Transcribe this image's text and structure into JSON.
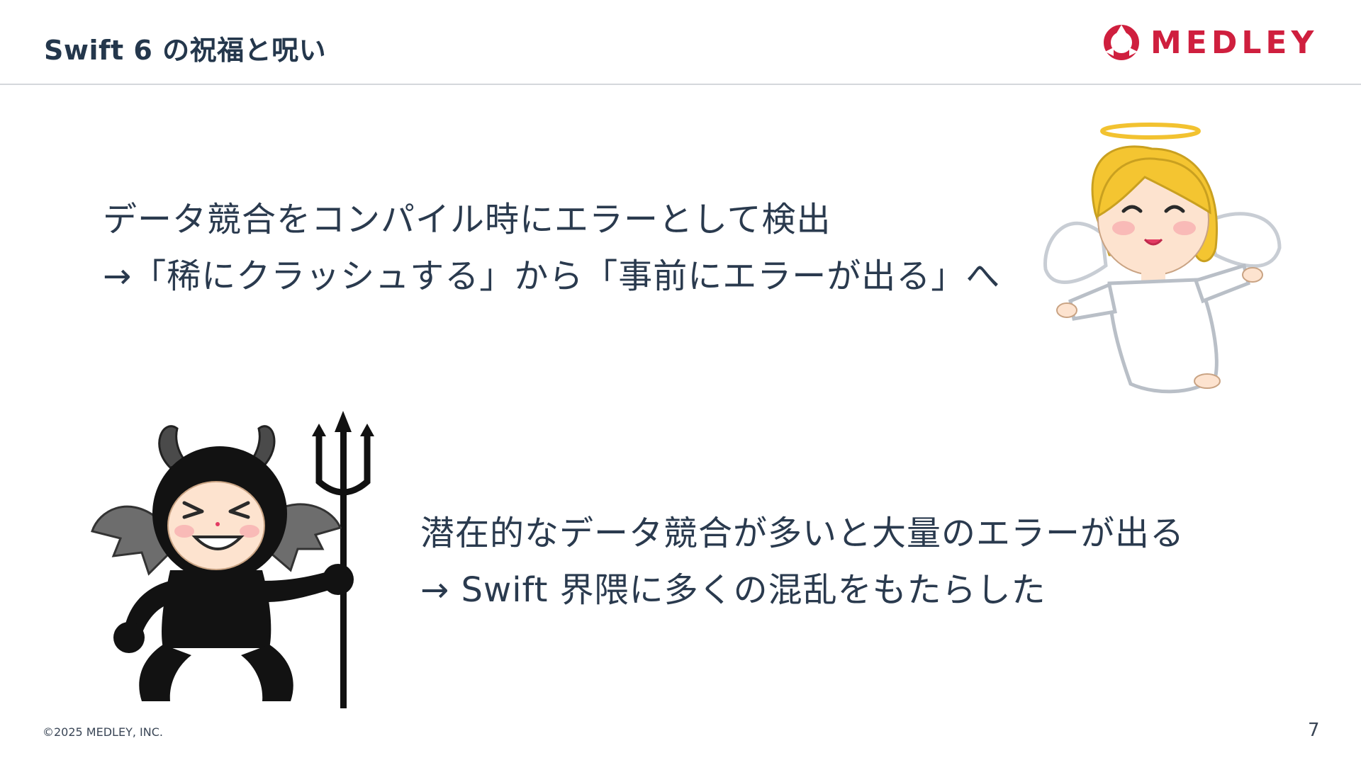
{
  "slide": {
    "title": "Swift 6 の祝福と呪い",
    "logo_text": "MEDLEY",
    "angel": {
      "line1": "データ競合をコンパイル時にエラーとして検出",
      "line2": "→「稀にクラッシュする」から「事前にエラーが出る」へ"
    },
    "devil": {
      "line1": "潜在的なデータ競合が多いと大量のエラーが出る",
      "line2": "→ Swift 界隈に多くの混乱をもたらした"
    },
    "footer": {
      "copyright": "©2025 MEDLEY, INC.",
      "page_number": "7"
    }
  },
  "colors": {
    "brand": "#cf1f3e",
    "text": "#2a3a4e",
    "divider": "#d4d7db"
  }
}
